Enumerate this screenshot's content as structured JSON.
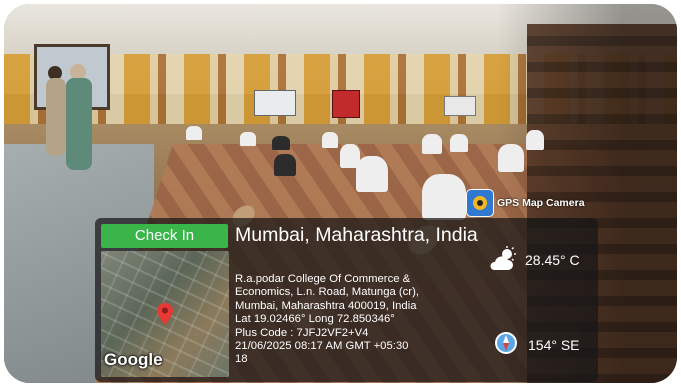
{
  "overlay": {
    "check_in_label": "Check In",
    "place_title": "Mumbai, Maharashtra, India",
    "address_lines": [
      "R.a.podar College Of Commerce &",
      "Economics, L.n. Road, Matunga (cr),",
      "Mumbai, Maharashtra 400019, India",
      "Lat 19.02466° Long 72.850346°",
      "Plus Code : 7JFJ2VF2+V4",
      "21/06/2025 08:17 AM GMT +05:30",
      "18"
    ],
    "map_provider": "Google",
    "app_name": "GPS Map Camera",
    "temperature": "28.45° C",
    "bearing": "154° SE"
  },
  "icons": {
    "weather": "cloud-sun-icon",
    "compass": "compass-icon",
    "app": "gps-map-camera-icon",
    "pin": "map-pin-icon"
  },
  "colors": {
    "check_in_bg": "#39b54a",
    "pin": "#e53935",
    "panel_bg": "rgba(22,22,24,0.72)"
  }
}
